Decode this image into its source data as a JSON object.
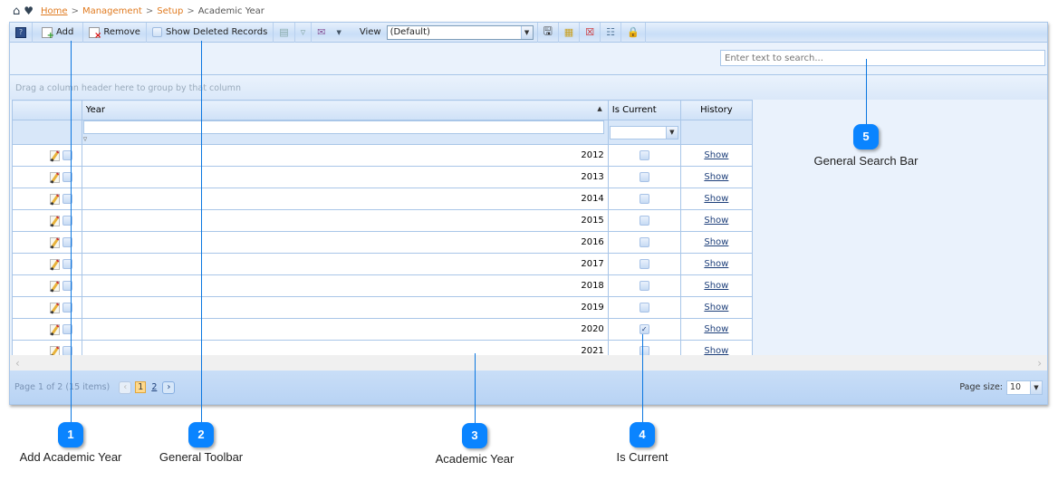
{
  "breadcrumb": {
    "items": [
      "Home",
      "Management",
      "Setup",
      "Academic Year"
    ],
    "separator": ">"
  },
  "toolbar": {
    "add_label": "Add",
    "remove_label": "Remove",
    "show_deleted_label": "Show Deleted Records",
    "view_label": "View",
    "view_selected": "(Default)"
  },
  "search": {
    "placeholder": "Enter text to search..."
  },
  "groupbar": {
    "text": "Drag a column header here to group by that column"
  },
  "grid": {
    "columns": [
      "Year",
      "Is Current",
      "History"
    ],
    "rows": [
      {
        "year": "2012",
        "is_current": false,
        "history": "Show"
      },
      {
        "year": "2013",
        "is_current": false,
        "history": "Show"
      },
      {
        "year": "2014",
        "is_current": false,
        "history": "Show"
      },
      {
        "year": "2015",
        "is_current": false,
        "history": "Show"
      },
      {
        "year": "2016",
        "is_current": false,
        "history": "Show"
      },
      {
        "year": "2017",
        "is_current": false,
        "history": "Show"
      },
      {
        "year": "2018",
        "is_current": false,
        "history": "Show"
      },
      {
        "year": "2019",
        "is_current": false,
        "history": "Show"
      },
      {
        "year": "2020",
        "is_current": true,
        "history": "Show"
      },
      {
        "year": "2021",
        "is_current": false,
        "history": "Show"
      }
    ]
  },
  "pager": {
    "summary": "Page 1 of 2 (15 items)",
    "pages": [
      "1",
      "2"
    ],
    "current_page": "1",
    "page_size_label": "Page size:",
    "page_size": "10"
  },
  "callouts": [
    {
      "num": "1",
      "label": "Add Academic Year"
    },
    {
      "num": "2",
      "label": "General Toolbar"
    },
    {
      "num": "3",
      "label": "Academic Year"
    },
    {
      "num": "4",
      "label": "Is Current"
    },
    {
      "num": "5",
      "label": "General Search Bar"
    }
  ],
  "colors": {
    "accent": "#0a84ff",
    "link": "#e07a1f",
    "grid_border": "#a9c6e8"
  }
}
